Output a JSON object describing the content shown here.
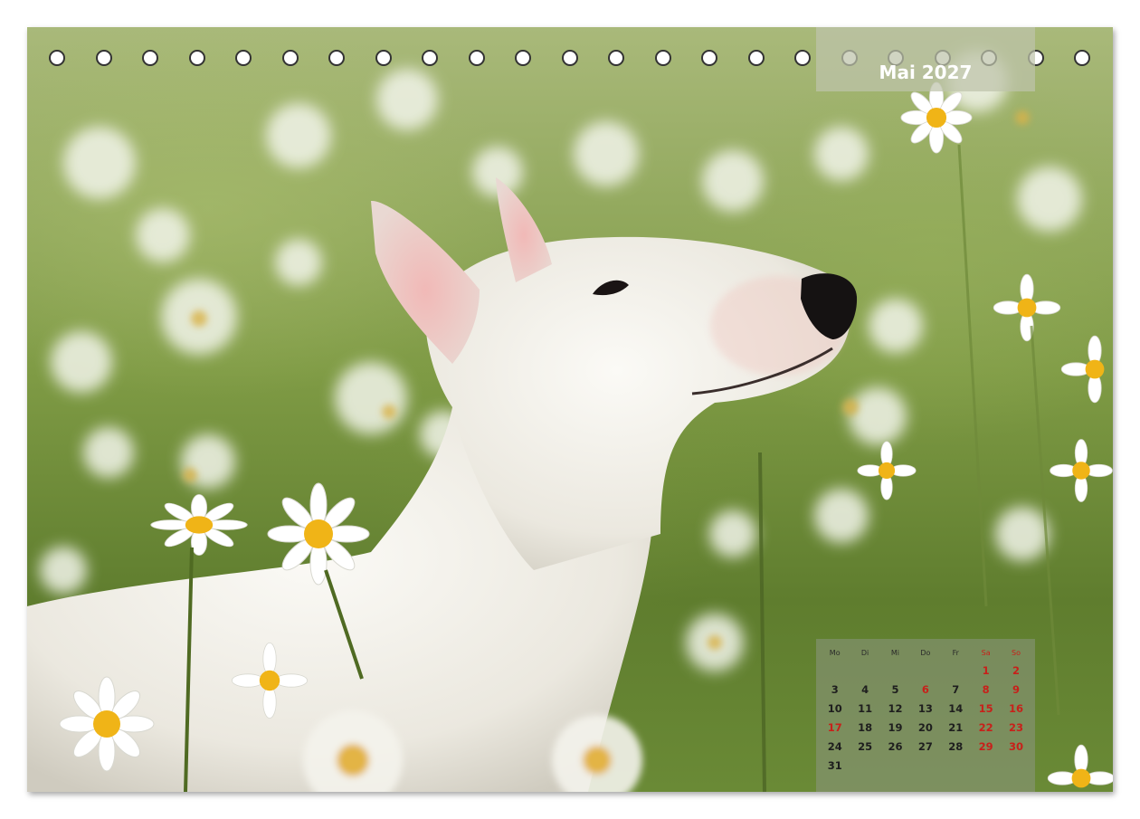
{
  "month_title": "Mai 2027",
  "calendar": {
    "weekdays": [
      "Mo",
      "Di",
      "Mi",
      "Do",
      "Fr",
      "Sa",
      "So"
    ],
    "weeks": [
      [
        "",
        "",
        "",
        "",
        "",
        "1",
        "2"
      ],
      [
        "3",
        "4",
        "5",
        "6",
        "7",
        "8",
        "9"
      ],
      [
        "10",
        "11",
        "12",
        "13",
        "14",
        "15",
        "16"
      ],
      [
        "17",
        "18",
        "19",
        "20",
        "21",
        "22",
        "23"
      ],
      [
        "24",
        "25",
        "26",
        "27",
        "28",
        "29",
        "30"
      ],
      [
        "31",
        "",
        "",
        "",
        "",
        "",
        ""
      ]
    ],
    "holidays": [
      "6",
      "17"
    ],
    "accent_color": "#c8201a"
  },
  "photo": {
    "subject_icon": "white-dog-in-daisy-field"
  }
}
